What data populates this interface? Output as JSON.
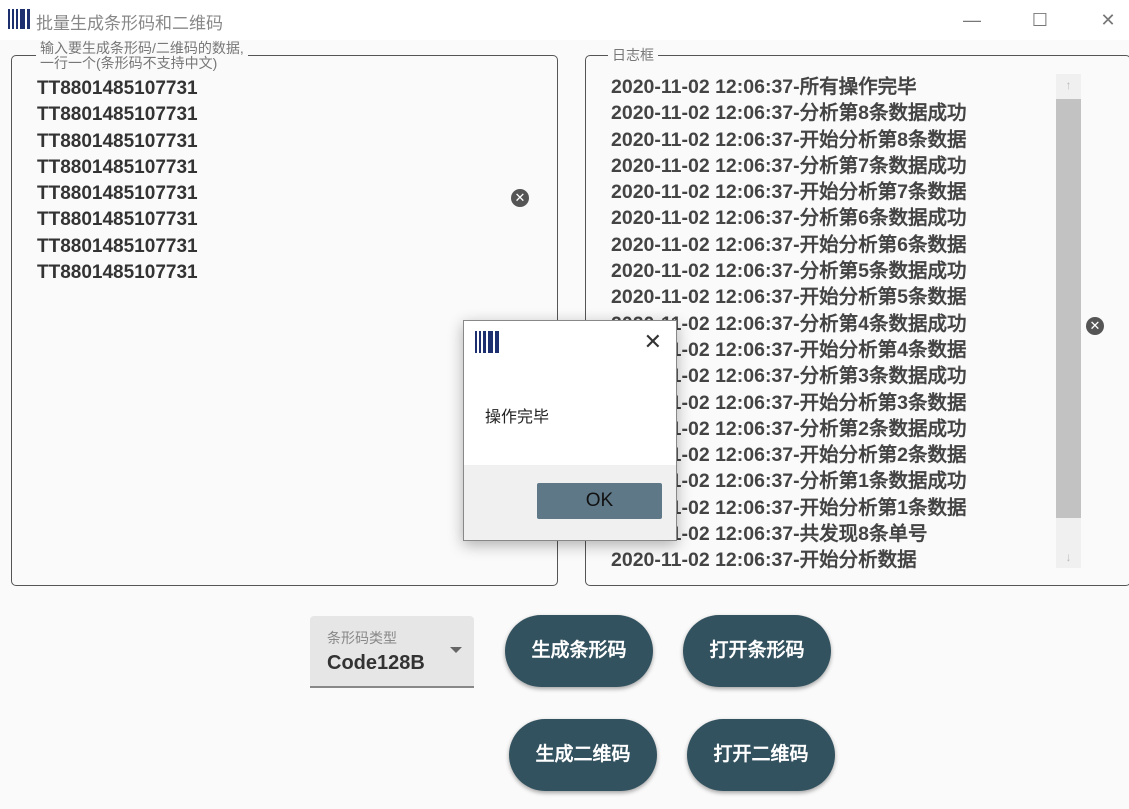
{
  "window": {
    "title": "批量生成条形码和二维码",
    "minimize": "—",
    "maximize": "☐",
    "close": "✕"
  },
  "input_group": {
    "legend_line1": "输入要生成条形码/二维码的数据,",
    "legend_line2": "一行一个(条形码不支持中文)",
    "lines": [
      "TT8801485107731",
      "TT8801485107731",
      "TT8801485107731",
      "TT8801485107731",
      "TT8801485107731",
      "TT8801485107731",
      "TT8801485107731",
      "TT8801485107731"
    ]
  },
  "log_group": {
    "legend": "日志框",
    "lines": [
      "2020-11-02 12:06:37-所有操作完毕",
      "2020-11-02 12:06:37-分析第8条数据成功",
      "2020-11-02 12:06:37-开始分析第8条数据",
      "2020-11-02 12:06:37-分析第7条数据成功",
      "2020-11-02 12:06:37-开始分析第7条数据",
      "2020-11-02 12:06:37-分析第6条数据成功",
      "2020-11-02 12:06:37-开始分析第6条数据",
      "2020-11-02 12:06:37-分析第5条数据成功",
      "2020-11-02 12:06:37-开始分析第5条数据",
      "2020-11-02 12:06:37-分析第4条数据成功",
      "2020-11-02 12:06:37-开始分析第4条数据",
      "2020-11-02 12:06:37-分析第3条数据成功",
      "2020-11-02 12:06:37-开始分析第3条数据",
      "2020-11-02 12:06:37-分析第2条数据成功",
      "2020-11-02 12:06:37-开始分析第2条数据",
      "2020-11-02 12:06:37-分析第1条数据成功",
      "2020-11-02 12:06:37-开始分析第1条数据",
      "2020-11-02 12:06:37-共发现8条单号",
      "2020-11-02 12:06:37-开始分析数据"
    ]
  },
  "clear_glyph": "✕",
  "barcode_type": {
    "label": "条形码类型",
    "value": "Code128B"
  },
  "buttons": {
    "gen_barcode": "生成条形码",
    "open_barcode": "打开条形码",
    "gen_qr": "生成二维码",
    "open_qr": "打开二维码"
  },
  "dialog": {
    "message": "操作完毕",
    "ok": "OK",
    "close": "✕"
  }
}
